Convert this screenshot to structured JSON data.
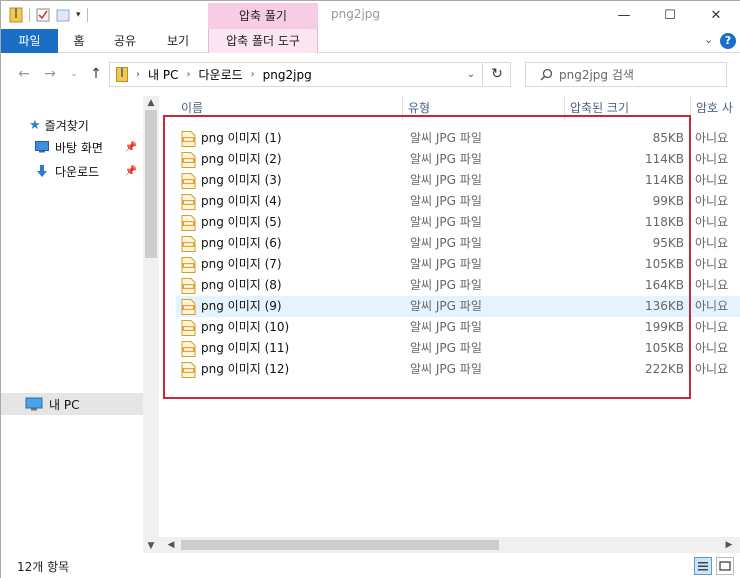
{
  "window": {
    "title": "png2jpg",
    "context_tab_header": "압축 풀기",
    "controls": {
      "minimize": "—",
      "maximize": "☐",
      "close": "✕"
    }
  },
  "ribbon": {
    "tabs": [
      {
        "label": "파일"
      },
      {
        "label": "홈"
      },
      {
        "label": "공유"
      },
      {
        "label": "보기"
      },
      {
        "label": "압축 폴더 도구"
      }
    ],
    "collapse": "⌄",
    "help": "?"
  },
  "address": {
    "crumbs": [
      "내 PC",
      "다운로드",
      "png2jpg"
    ],
    "search_placeholder": "png2jpg 검색"
  },
  "nav": {
    "quick_access": "즐겨찾기",
    "desktop": "바탕 화면",
    "downloads": "다운로드",
    "this_pc": "내 PC"
  },
  "columns": {
    "name": "이름",
    "type": "유형",
    "compressed_size": "압축된 크기",
    "password": "암호 사"
  },
  "files": [
    {
      "name": "png 이미지 (1)",
      "type": "알씨 JPG 파일",
      "size": "85KB",
      "password": "아니요"
    },
    {
      "name": "png 이미지 (2)",
      "type": "알씨 JPG 파일",
      "size": "114KB",
      "password": "아니요"
    },
    {
      "name": "png 이미지 (3)",
      "type": "알씨 JPG 파일",
      "size": "114KB",
      "password": "아니요"
    },
    {
      "name": "png 이미지 (4)",
      "type": "알씨 JPG 파일",
      "size": "99KB",
      "password": "아니요"
    },
    {
      "name": "png 이미지 (5)",
      "type": "알씨 JPG 파일",
      "size": "118KB",
      "password": "아니요"
    },
    {
      "name": "png 이미지 (6)",
      "type": "알씨 JPG 파일",
      "size": "95KB",
      "password": "아니요"
    },
    {
      "name": "png 이미지 (7)",
      "type": "알씨 JPG 파일",
      "size": "105KB",
      "password": "아니요"
    },
    {
      "name": "png 이미지 (8)",
      "type": "알씨 JPG 파일",
      "size": "164KB",
      "password": "아니요"
    },
    {
      "name": "png 이미지 (9)",
      "type": "알씨 JPG 파일",
      "size": "136KB",
      "password": "아니요"
    },
    {
      "name": "png 이미지 (10)",
      "type": "알씨 JPG 파일",
      "size": "199KB",
      "password": "아니요"
    },
    {
      "name": "png 이미지 (11)",
      "type": "알씨 JPG 파일",
      "size": "105KB",
      "password": "아니요"
    },
    {
      "name": "png 이미지 (12)",
      "type": "알씨 JPG 파일",
      "size": "222KB",
      "password": "아니요"
    }
  ],
  "hovered_row": 8,
  "status": {
    "item_count": "12개 항목"
  },
  "colors": {
    "accent": "#1a6fc4",
    "context_tab": "#f7cde6",
    "highlight_box": "#c8283c",
    "hover_row": "#e5f3ff"
  }
}
